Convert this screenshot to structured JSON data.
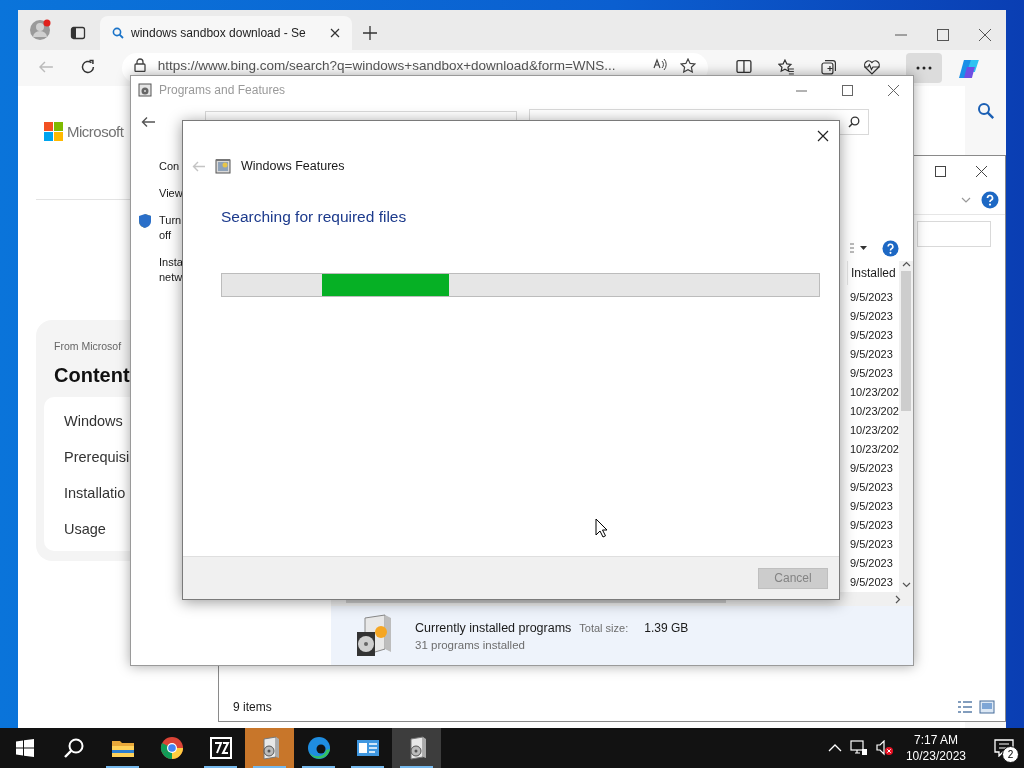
{
  "browser": {
    "tab": {
      "title": "windows sandbox download - Se",
      "selected": true
    },
    "url": "https://www.bing.com/search?q=windows+sandbox+download&form=WNS...",
    "page": {
      "logo_text": "Microsoft",
      "source": "From Microsof",
      "heading": "Content",
      "links": [
        "Windows",
        "Prerequisi",
        "Installatio",
        "Usage"
      ]
    }
  },
  "explorer": {
    "status": "9 items"
  },
  "programs_window": {
    "title": "Programs and Features",
    "tasks": [
      {
        "label": "Con",
        "shield": false
      },
      {
        "label": "View",
        "shield": false
      },
      {
        "label": "Turn off",
        "shield": true
      },
      {
        "label": "Insta netw",
        "shield": false
      }
    ],
    "column_header": "Installed",
    "dates": [
      "9/5/2023",
      "9/5/2023",
      "9/5/2023",
      "9/5/2023",
      "9/5/2023",
      "10/23/202",
      "10/23/202",
      "10/23/202",
      "10/23/202",
      "9/5/2023",
      "9/5/2023",
      "9/5/2023",
      "9/5/2023",
      "9/5/2023",
      "9/5/2023",
      "9/5/2023"
    ],
    "details": {
      "title": "Currently installed programs",
      "size_label": "Total size:",
      "size": "1.39 GB",
      "count": "31 programs installed"
    }
  },
  "dialog": {
    "title": "Windows Features",
    "heading": "Searching for required files",
    "progress": {
      "indeterminate": true
    },
    "buttons": [
      {
        "label": "Cancel",
        "disabled": true
      }
    ]
  },
  "taskbar": {
    "items": [
      {
        "kind": "start",
        "running": false,
        "flashing": false,
        "active": false
      },
      {
        "kind": "search",
        "running": false,
        "flashing": false,
        "active": false
      },
      {
        "kind": "folder",
        "running": true,
        "flashing": false,
        "active": false
      },
      {
        "kind": "chrome",
        "running": false,
        "flashing": false,
        "active": false
      },
      {
        "kind": "archiver",
        "running": true,
        "flashing": false,
        "active": false
      },
      {
        "kind": "programs",
        "running": true,
        "flashing": true,
        "active": false
      },
      {
        "kind": "edge",
        "running": true,
        "flashing": false,
        "active": false
      },
      {
        "kind": "panel",
        "running": true,
        "flashing": false,
        "active": false
      },
      {
        "kind": "programs",
        "running": true,
        "flashing": false,
        "active": true
      }
    ],
    "time": "7:17 AM",
    "date": "10/23/2023",
    "notifications": "2"
  }
}
